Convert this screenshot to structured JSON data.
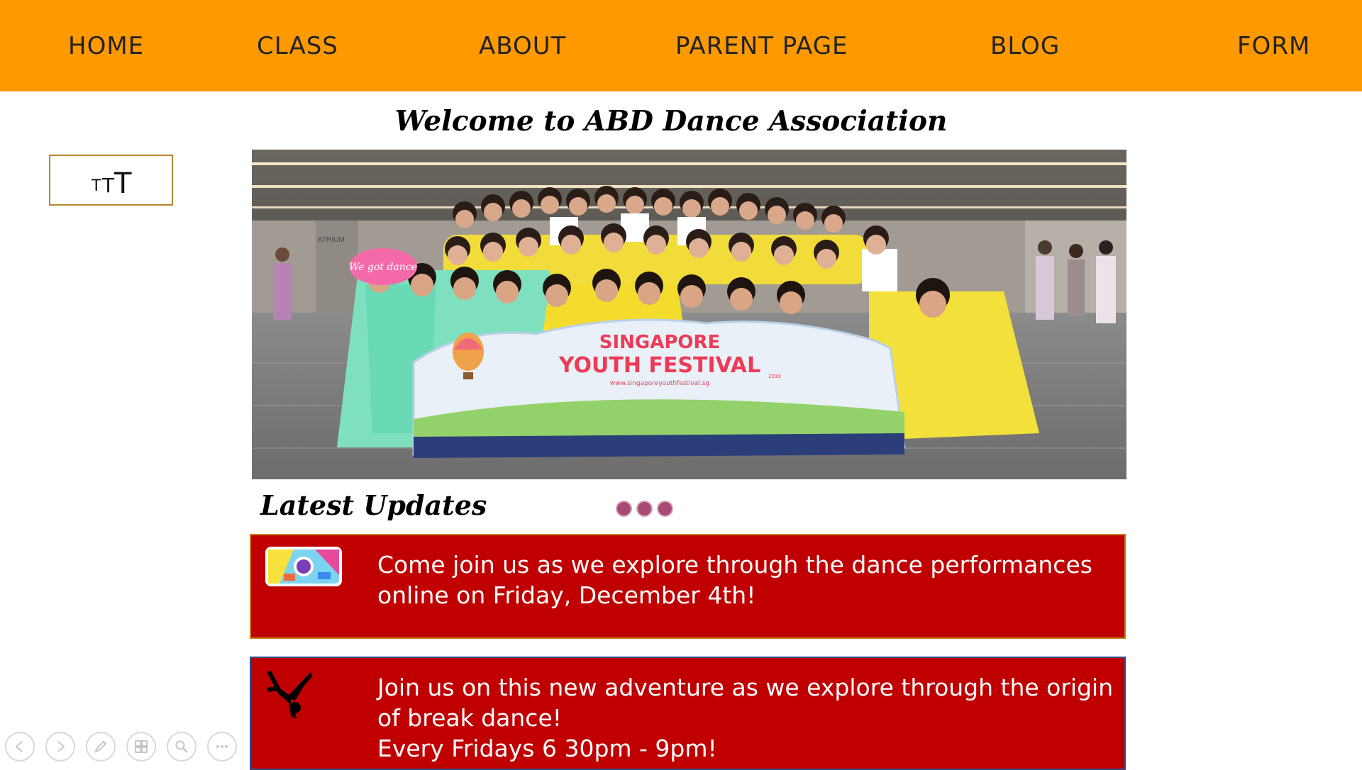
{
  "nav": {
    "items": [
      "HOME",
      "CLASS",
      "ABOUT",
      "PARENT PAGE",
      "BLOG",
      "FORM"
    ]
  },
  "header": {
    "welcome": "Welcome to ABD Dance Association"
  },
  "textsize": {
    "small": "T",
    "medium": "T",
    "large": "T"
  },
  "hero": {
    "banner_line1": "SINGAPORE",
    "banner_line2": "YOUTH FESTIVAL",
    "banner_year": "2019",
    "banner_url": "www.singaporeyouthfestival.sg",
    "sign_text": "We got dance",
    "wall_text": "ATRIUM"
  },
  "updates": {
    "title": "Latest Updates",
    "items": [
      {
        "text": "Come join us as we explore through the dance performances online on Friday, December 4th!",
        "icon": "dance-game-icon"
      },
      {
        "text_line1": "Join us on this new adventure as we explore through the origin of break dance!",
        "text_line2": "Every Fridays 6 30pm - 9pm!",
        "icon": "breakdancer-icon"
      }
    ]
  },
  "colors": {
    "nav_bg": "#ff9900",
    "card_bg": "#c00000",
    "dot": "#a94a73"
  },
  "toolbar": {
    "icons": [
      "previous-icon",
      "next-icon",
      "pen-icon",
      "slides-icon",
      "zoom-icon",
      "more-icon"
    ]
  }
}
